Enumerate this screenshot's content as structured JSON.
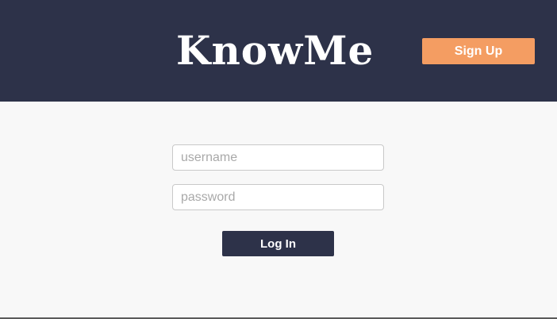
{
  "header": {
    "logo_text": "KnowMe",
    "signup_label": "Sign Up"
  },
  "login_form": {
    "username_placeholder": "username",
    "password_placeholder": "password",
    "login_label": "Log In"
  },
  "colors": {
    "header_bg": "#2d3249",
    "accent": "#f49d62",
    "page_bg": "#f8f8f8"
  }
}
